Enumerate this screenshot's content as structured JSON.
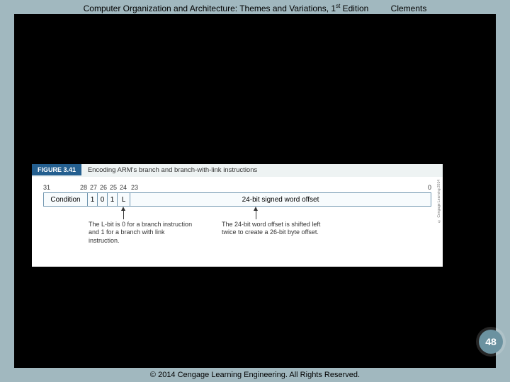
{
  "header": {
    "title_prefix": "Computer Organization and Architecture: Themes and Variations, 1",
    "title_sup": "st",
    "title_suffix": " Edition",
    "author": "Clements"
  },
  "figure": {
    "label": "FIGURE 3.41",
    "caption": "Encoding ARM's branch and branch-with-link instructions",
    "bits": {
      "b31": "31",
      "b28": "28",
      "b27": "27",
      "b26": "26",
      "b25": "25",
      "b24": "24",
      "b23": "23",
      "b0": "0"
    },
    "cells": {
      "condition": "Condition",
      "c1": "1",
      "c2": "0",
      "c3": "1",
      "L": "L",
      "offset": "24-bit signed word offset"
    },
    "note1": "The L-bit is 0 for a branch instruction and 1 for a branch with link instruction.",
    "note2": "The 24-bit word offset is shifted left twice to create a 26-bit byte offset.",
    "credit": "© Cengage Learning 2014"
  },
  "page_number": "48",
  "footer": "© 2014 Cengage Learning Engineering. All Rights Reserved."
}
